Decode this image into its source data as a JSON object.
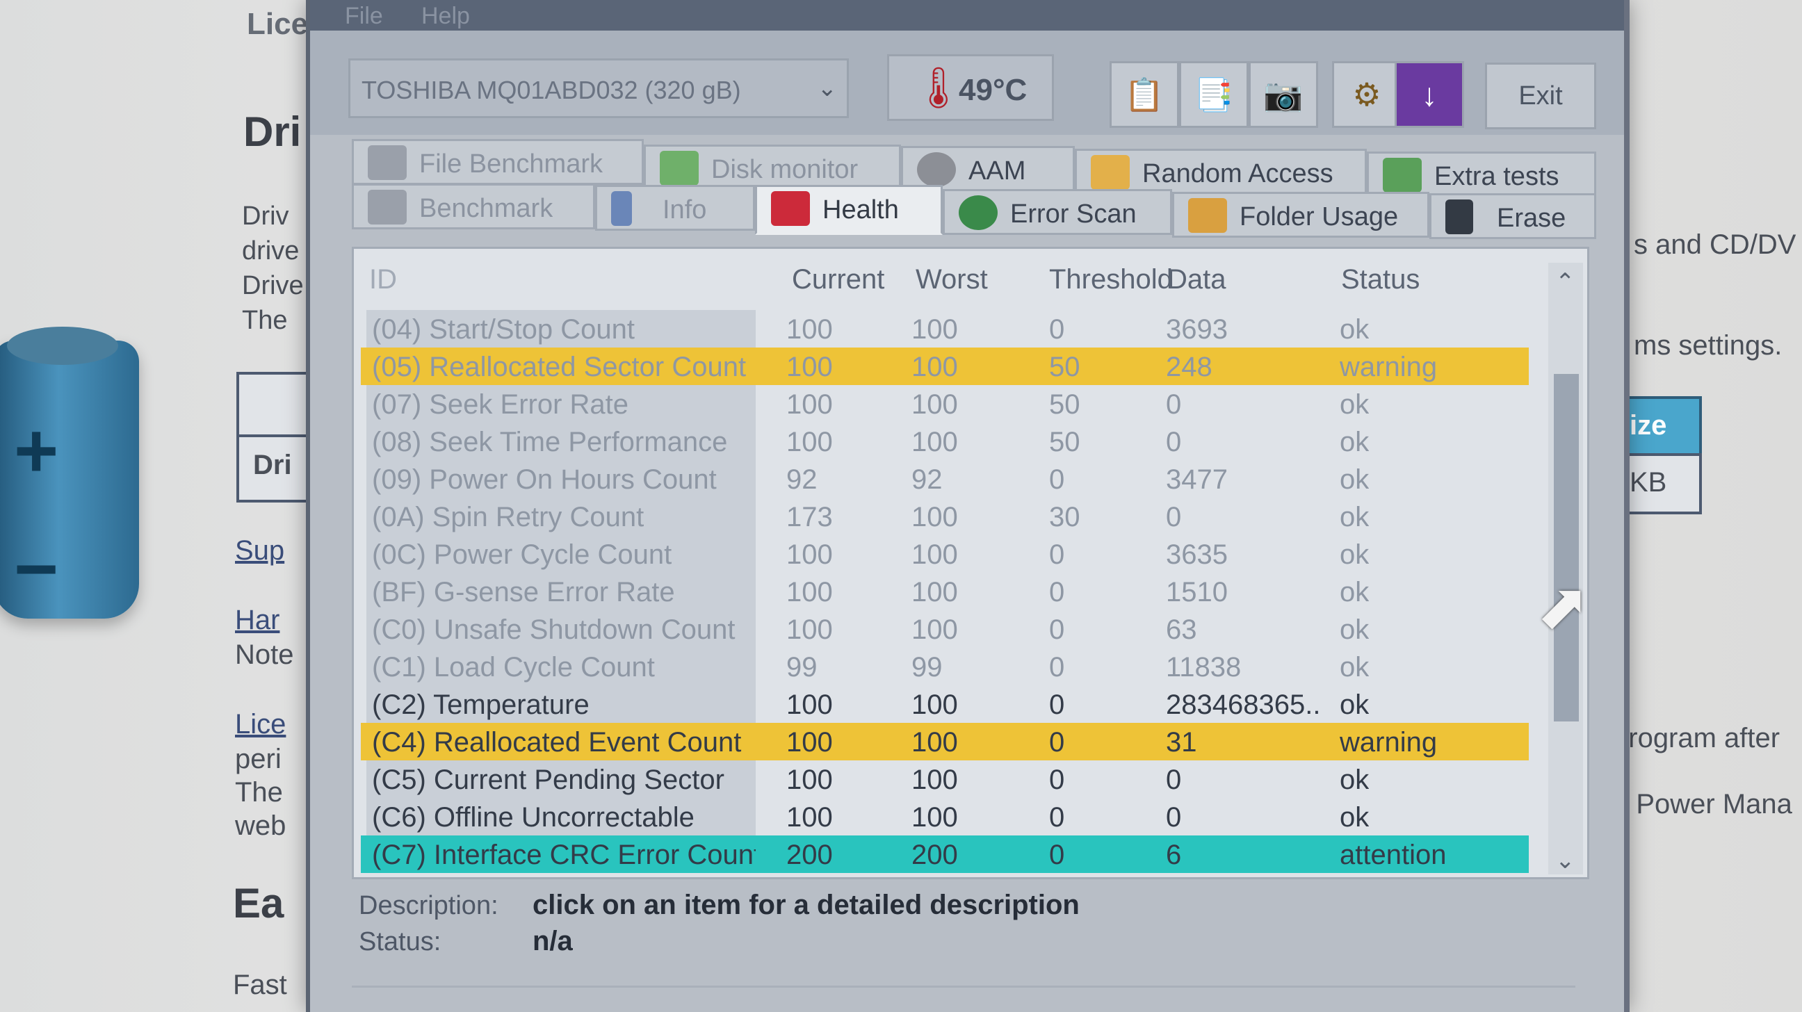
{
  "background_page": {
    "left_texts": [
      "Lice",
      "Dri",
      "Driv",
      "drive",
      "Drive",
      "The",
      "Dri",
      "Sup",
      "Har",
      "Note",
      "Lice",
      "peri",
      "The",
      "web",
      "Ea",
      "Fast"
    ],
    "right_texts": [
      "s and CD/DV",
      "ms settings.",
      "ize",
      "KB",
      "program after",
      "e Power Mana"
    ]
  },
  "menu": {
    "items": [
      "File",
      "Help"
    ]
  },
  "toolbar": {
    "drive": "TOSHIBA MQ01ABD032 (320 gB)",
    "temperature": "49°C",
    "exit_label": "Exit",
    "icons": [
      "copy-text-icon",
      "copy-info-icon",
      "screenshot-icon",
      "settings-icon",
      "save-icon"
    ]
  },
  "tabs": {
    "row1": [
      "File Benchmark",
      "Disk monitor",
      "AAM",
      "Random Access",
      "Extra tests"
    ],
    "row2": [
      "Benchmark",
      "Info",
      "Health",
      "Error Scan",
      "Folder Usage",
      "Erase"
    ],
    "active": "Health"
  },
  "table": {
    "headers": [
      "ID",
      "Current",
      "Worst",
      "Threshold",
      "Data",
      "Status"
    ],
    "rows": [
      {
        "id": "(04) Start/Stop Count",
        "current": "100",
        "worst": "100",
        "threshold": "0",
        "data": "3693",
        "status": "ok"
      },
      {
        "id": "(05) Reallocated Sector Count",
        "current": "100",
        "worst": "100",
        "threshold": "50",
        "data": "248",
        "status": "warning"
      },
      {
        "id": "(07) Seek Error Rate",
        "current": "100",
        "worst": "100",
        "threshold": "50",
        "data": "0",
        "status": "ok"
      },
      {
        "id": "(08) Seek Time Performance",
        "current": "100",
        "worst": "100",
        "threshold": "50",
        "data": "0",
        "status": "ok"
      },
      {
        "id": "(09) Power On Hours Count",
        "current": "92",
        "worst": "92",
        "threshold": "0",
        "data": "3477",
        "status": "ok"
      },
      {
        "id": "(0A) Spin Retry Count",
        "current": "173",
        "worst": "100",
        "threshold": "30",
        "data": "0",
        "status": "ok"
      },
      {
        "id": "(0C) Power Cycle Count",
        "current": "100",
        "worst": "100",
        "threshold": "0",
        "data": "3635",
        "status": "ok"
      },
      {
        "id": "(BF) G-sense Error Rate",
        "current": "100",
        "worst": "100",
        "threshold": "0",
        "data": "1510",
        "status": "ok"
      },
      {
        "id": "(C0) Unsafe Shutdown Count",
        "current": "100",
        "worst": "100",
        "threshold": "0",
        "data": "63",
        "status": "ok"
      },
      {
        "id": "(C1) Load Cycle Count",
        "current": "99",
        "worst": "99",
        "threshold": "0",
        "data": "11838",
        "status": "ok"
      },
      {
        "id": "(C2) Temperature",
        "current": "100",
        "worst": "100",
        "threshold": "0",
        "data": "283468365...",
        "status": "ok"
      },
      {
        "id": "(C4) Reallocated Event Count",
        "current": "100",
        "worst": "100",
        "threshold": "0",
        "data": "31",
        "status": "warning"
      },
      {
        "id": "(C5) Current Pending Sector",
        "current": "100",
        "worst": "100",
        "threshold": "0",
        "data": "0",
        "status": "ok"
      },
      {
        "id": "(C6) Offline Uncorrectable",
        "current": "100",
        "worst": "100",
        "threshold": "0",
        "data": "0",
        "status": "ok"
      },
      {
        "id": "(C7) Interface CRC Error Count",
        "current": "200",
        "worst": "200",
        "threshold": "0",
        "data": "6",
        "status": "attention"
      }
    ]
  },
  "description": {
    "desc_label": "Description:",
    "desc_value": "click on an item for a detailed description",
    "status_label": "Status:",
    "status_value": "n/a"
  },
  "colors": {
    "warning": "#eec337",
    "attention": "#29c4be",
    "window_bg": "#b8bec6"
  }
}
